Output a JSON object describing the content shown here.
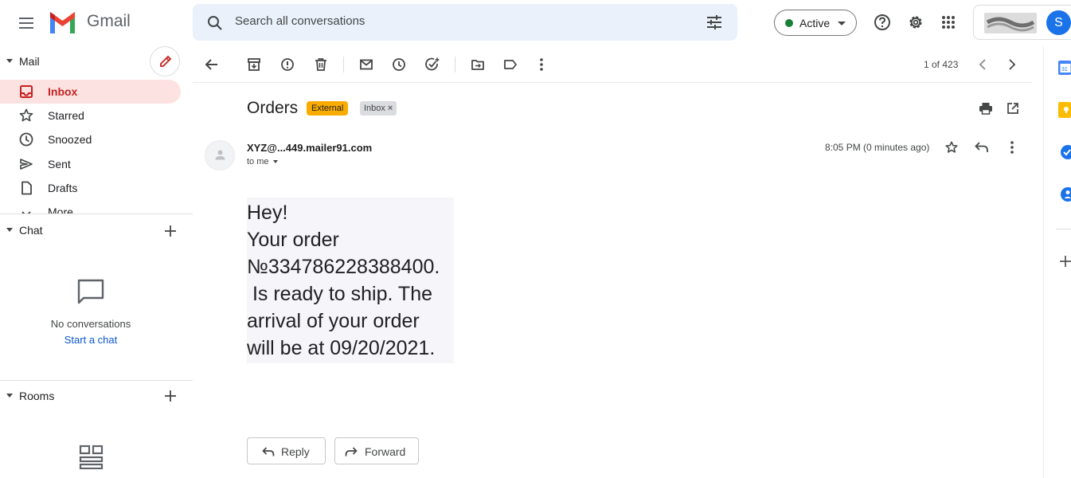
{
  "header": {
    "app_name": "Gmail",
    "search_placeholder": "Search all conversations",
    "status": "Active",
    "avatar_letter": "S"
  },
  "sidebar": {
    "mail_section": "Mail",
    "items": [
      {
        "label": "Inbox",
        "icon": "inbox-icon",
        "active": true
      },
      {
        "label": "Starred",
        "icon": "star-icon"
      },
      {
        "label": "Snoozed",
        "icon": "clock-icon"
      },
      {
        "label": "Sent",
        "icon": "send-icon"
      },
      {
        "label": "Drafts",
        "icon": "draft-icon"
      },
      {
        "label": "More",
        "icon": "chevron-down-icon"
      }
    ],
    "chat_section": "Chat",
    "no_conversations": "No conversations",
    "start_chat": "Start a chat",
    "rooms_section": "Rooms"
  },
  "toolbar": {
    "page_count": "1 of 423"
  },
  "message": {
    "subject": "Orders",
    "labels": {
      "external": "External",
      "inbox": "Inbox",
      "inbox_remove": "×"
    },
    "sender": "XYZ@...449.mailer91.com",
    "recipient": "to me",
    "timestamp": "8:05 PM (0 minutes ago)",
    "body_lines": [
      "Hey!",
      "Your order",
      "№334786228388400.",
      " Is ready to ship. The",
      "arrival of your order",
      "will be at 09/20/2021."
    ]
  },
  "actions": {
    "reply": "Reply",
    "forward": "Forward"
  },
  "colors": {
    "accent_red": "#c5221f",
    "active_bg": "#fce3e2",
    "search_bg": "#eaf1fb",
    "external_label": "#f9ab00",
    "active_dot": "#188038",
    "link_blue": "#0b57d0"
  }
}
